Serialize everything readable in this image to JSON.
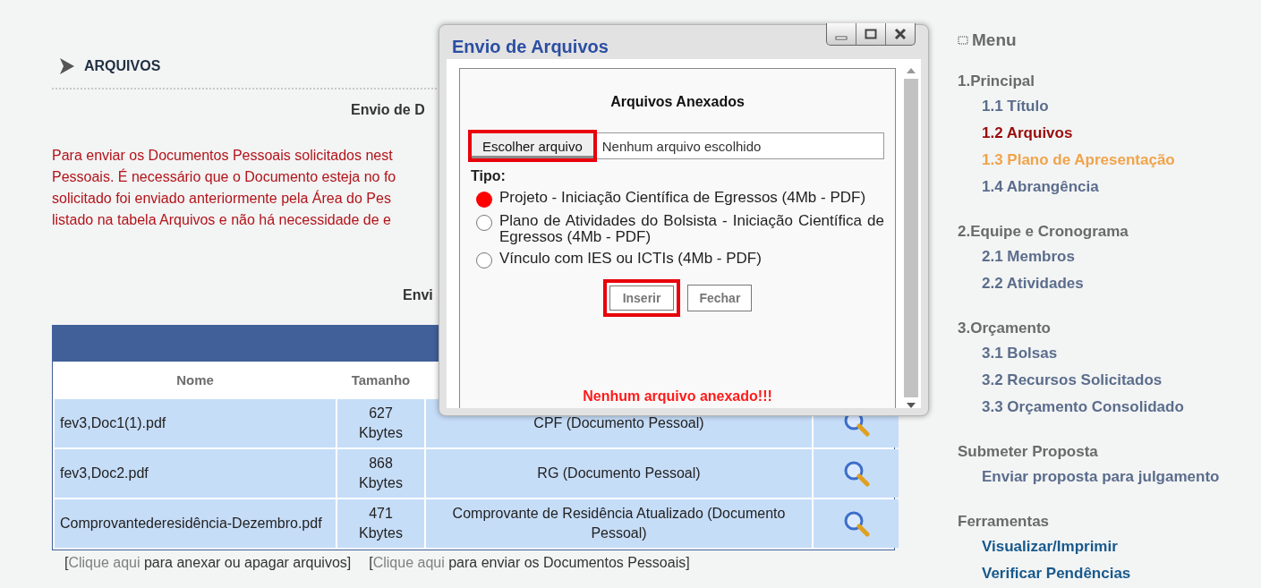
{
  "section": {
    "title": "ARQUIVOS"
  },
  "subtitle": "Envio de D",
  "notice_lines": [
    "Para enviar os Documentos Pessoais solicitados nest",
    "Pessoais. É necessário que o Documento esteja no fo",
    "solicitado foi enviado anteriormente pela Área do Pes",
    "listado na tabela Arquivos e não há necessidade de e"
  ],
  "subtitle_2": "Envi",
  "table": {
    "columns": [
      "Nome",
      "Tamanho"
    ],
    "rows": [
      {
        "name": "fev3,Doc1(1).pdf",
        "size": "627 Kbytes",
        "type": "CPF (Documento Pessoal)"
      },
      {
        "name": "fev3,Doc2.pdf",
        "size": "868 Kbytes",
        "type": "RG (Documento Pessoal)"
      },
      {
        "name": "Comprovantederesidência-Dezembro.pdf",
        "size": "471 Kbytes",
        "type": "Comprovante de Residência Atualizado (Documento Pessoal)"
      }
    ]
  },
  "links": [
    {
      "open": "[",
      "link": "Clique aqui",
      "text": " para anexar ou apagar arquivos]"
    },
    {
      "open": "[",
      "link": "Clique aqui",
      "text": " para enviar os Documentos Pessoais]"
    }
  ],
  "dialog": {
    "title": "Envio de Arquivos",
    "heading": "Arquivos Anexados",
    "file_button": {
      "label": "Escolher arquivo",
      "highlighted": true
    },
    "file_status": "Nenhum arquivo escolhido",
    "type_label": "Tipo:",
    "options": [
      {
        "label": "Projeto - Iniciação Científica de Egressos (4Mb - PDF)",
        "selected": true
      },
      {
        "label": "Plano de Atividades do Bolsista - Iniciação Científica de Egressos (4Mb - PDF)",
        "selected": false
      },
      {
        "label": "Vínculo com IES ou ICTIs (4Mb - PDF)",
        "selected": false
      }
    ],
    "buttons": [
      {
        "label": "Inserir",
        "highlighted": true
      },
      {
        "label": "Fechar",
        "highlighted": false
      }
    ],
    "message": "Nenhum arquivo anexado!!!"
  },
  "sidebar": {
    "title": "Menu",
    "groups": [
      {
        "title": "1.Principal",
        "items": [
          {
            "label": "1.1 Título",
            "color": "#5b6d8c"
          },
          {
            "label": "1.2 Arquivos",
            "color": "#990b0b"
          },
          {
            "label": "1.3 Plano de Apresentação",
            "color": "#f0a44a"
          },
          {
            "label": "1.4 Abrangência",
            "color": "#5b6d8c"
          }
        ]
      },
      {
        "title": "2.Equipe e Cronograma",
        "items": [
          {
            "label": "2.1 Membros",
            "color": "#5b6d8c"
          },
          {
            "label": "2.2 Atividades",
            "color": "#5b6d8c"
          }
        ]
      },
      {
        "title": "3.Orçamento",
        "items": [
          {
            "label": "3.1 Bolsas",
            "color": "#5b6d8c"
          },
          {
            "label": "3.2 Recursos Solicitados",
            "color": "#5b6d8c"
          },
          {
            "label": "3.3 Orçamento Consolidado",
            "color": "#5b6d8c"
          }
        ]
      },
      {
        "title": "Submeter Proposta",
        "items": [
          {
            "label": "Enviar proposta para julgamento",
            "color": "#5b6d8c"
          }
        ]
      },
      {
        "title": "Ferramentas",
        "items": [
          {
            "label": "Visualizar/Imprimir",
            "color": "#17598c"
          },
          {
            "label": "Verificar Pendências",
            "color": "#17598c"
          }
        ]
      }
    ]
  }
}
